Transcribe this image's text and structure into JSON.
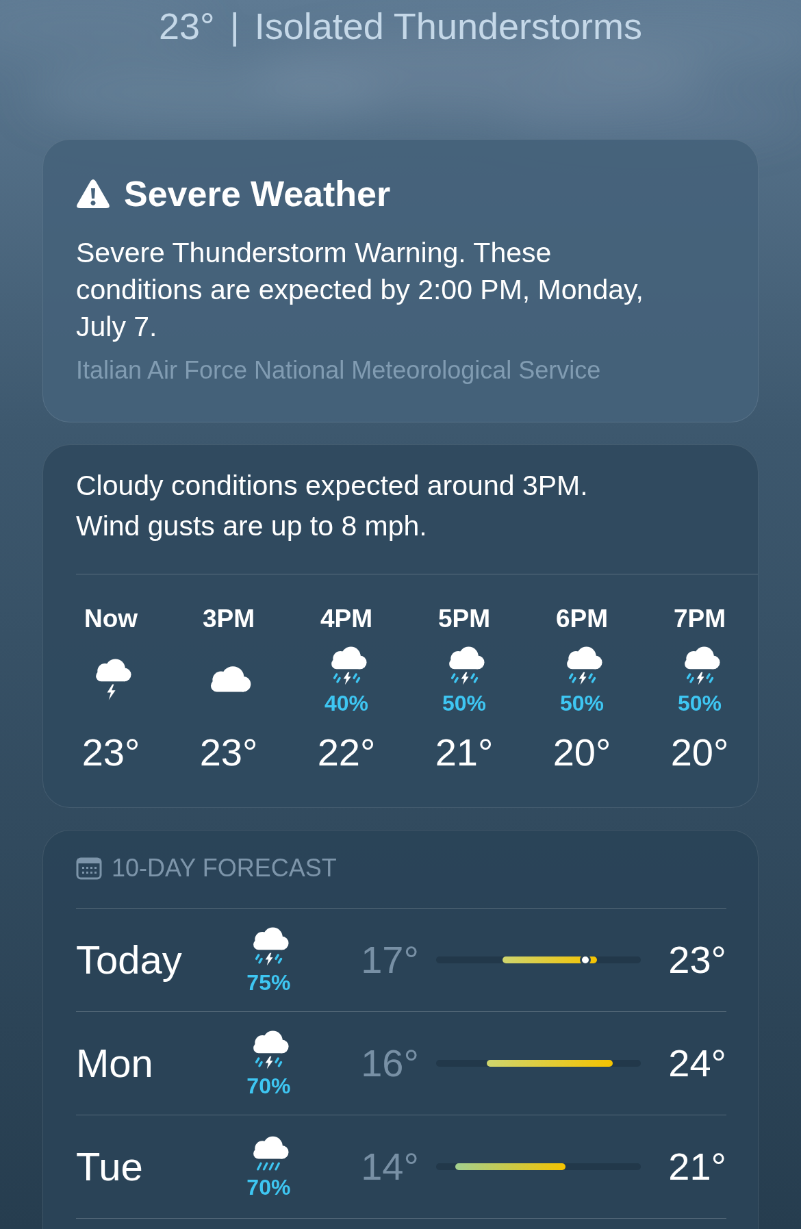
{
  "header": {
    "temperature": "23°",
    "separator": "|",
    "condition": "Isolated Thunderstorms"
  },
  "alert": {
    "title": "Severe Weather",
    "message": "Severe Thunderstorm Warning. These conditions are expected by 2:00 PM, Monday, July 7.",
    "source": "Italian Air Force National Meteorological Service"
  },
  "hourly": {
    "summary": "Cloudy conditions expected around 3PM. Wind gusts are up to 8 mph.",
    "hours": [
      {
        "time": "Now",
        "kind": "storm_cloud",
        "temp": "23°"
      },
      {
        "time": "3PM",
        "kind": "cloud",
        "temp": "23°"
      },
      {
        "time": "4PM",
        "kind": "thunderstorm",
        "precip": "40%",
        "temp": "22°"
      },
      {
        "time": "5PM",
        "kind": "thunderstorm",
        "precip": "50%",
        "temp": "21°"
      },
      {
        "time": "6PM",
        "kind": "thunderstorm",
        "precip": "50%",
        "temp": "20°"
      },
      {
        "time": "7PM",
        "kind": "thunderstorm",
        "precip": "50%",
        "temp": "20°"
      }
    ]
  },
  "ten_day": {
    "title": "10-DAY FORECAST",
    "days": [
      {
        "day": "Today",
        "kind": "thunderstorm",
        "precip": "75%",
        "low": "17°",
        "high": "23°",
        "level": 0.73
      },
      {
        "day": "Mon",
        "kind": "thunderstorm",
        "precip": "70%",
        "low": "16°",
        "high": "24°"
      },
      {
        "day": "Tue",
        "kind": "rain",
        "precip": "70%",
        "low": "14°",
        "high": "21°"
      }
    ]
  }
}
